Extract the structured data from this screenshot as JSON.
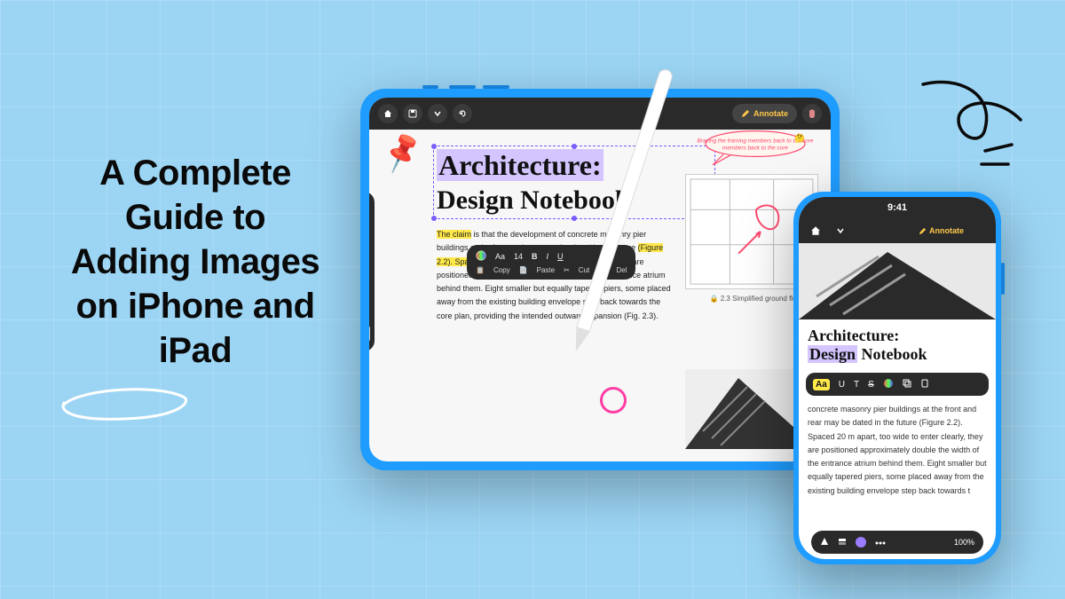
{
  "headline": "A Complete Guide to Adding Images on iPhone and iPad",
  "ipad": {
    "toolbar": {
      "annotate_label": "Annotate"
    },
    "document": {
      "title_line1": "Architecture:",
      "title_line2": "Design Notebook",
      "body": "The claim is that the development of concrete masonry pier buildings at the front and rear may be dated in the future (Figure 2.2). Spaced 20 m apart, too wide to enter clearly, they are positioned approximately double the width of the entrance atrium behind them. Eight smaller but equally tapered piers, some placed away from the existing building envelope step back towards the core plan, providing the intended outward expansion (Fig. 2.3).",
      "highlight_span1": "The claim",
      "highlight_span2": "(Figure 2.2). Spaced 20 m apart, too wide to enter clearly, th",
      "annotation_note": "Bracing the framing members back to the core",
      "thinking_emoji": "🤔",
      "floor_plan_caption": "2.3 Simplified ground floor plan"
    },
    "format_bar": {
      "font_label": "Aa",
      "font_size": "14",
      "bold": "B",
      "italic": "I",
      "underline": "U",
      "copy": "Copy",
      "paste": "Paste",
      "cut": "Cut",
      "delete": "Del"
    }
  },
  "iphone": {
    "status_time": "9:41",
    "toolbar": {
      "annotate_label": "Annotate"
    },
    "document": {
      "title_line1": "Architecture:",
      "title_word_design": "Design",
      "title_word_notebook": "Notebook",
      "body": "concrete masonry pier buildings at the front and rear may be dated in the future (Figure 2.2). Spaced 20 m apart, too wide to enter clearly, they are positioned approximately double the width of the entrance atrium behind them. Eight smaller but equally tapered piers, some placed away from the existing building envelope step back towards t"
    },
    "text_toolbar": {
      "aa": "Aa",
      "u": "U",
      "t": "T",
      "s": "S"
    },
    "bottom_bar": {
      "zoom": "100%"
    }
  },
  "colors": {
    "bg": "#9cd5f4",
    "device_blue": "#1f9cff",
    "highlight_purple": "#d4c5ff",
    "highlight_yellow": "#ffe94a",
    "annotate_gold": "#ffc84a",
    "pink_marker": "#ff3ea5"
  }
}
